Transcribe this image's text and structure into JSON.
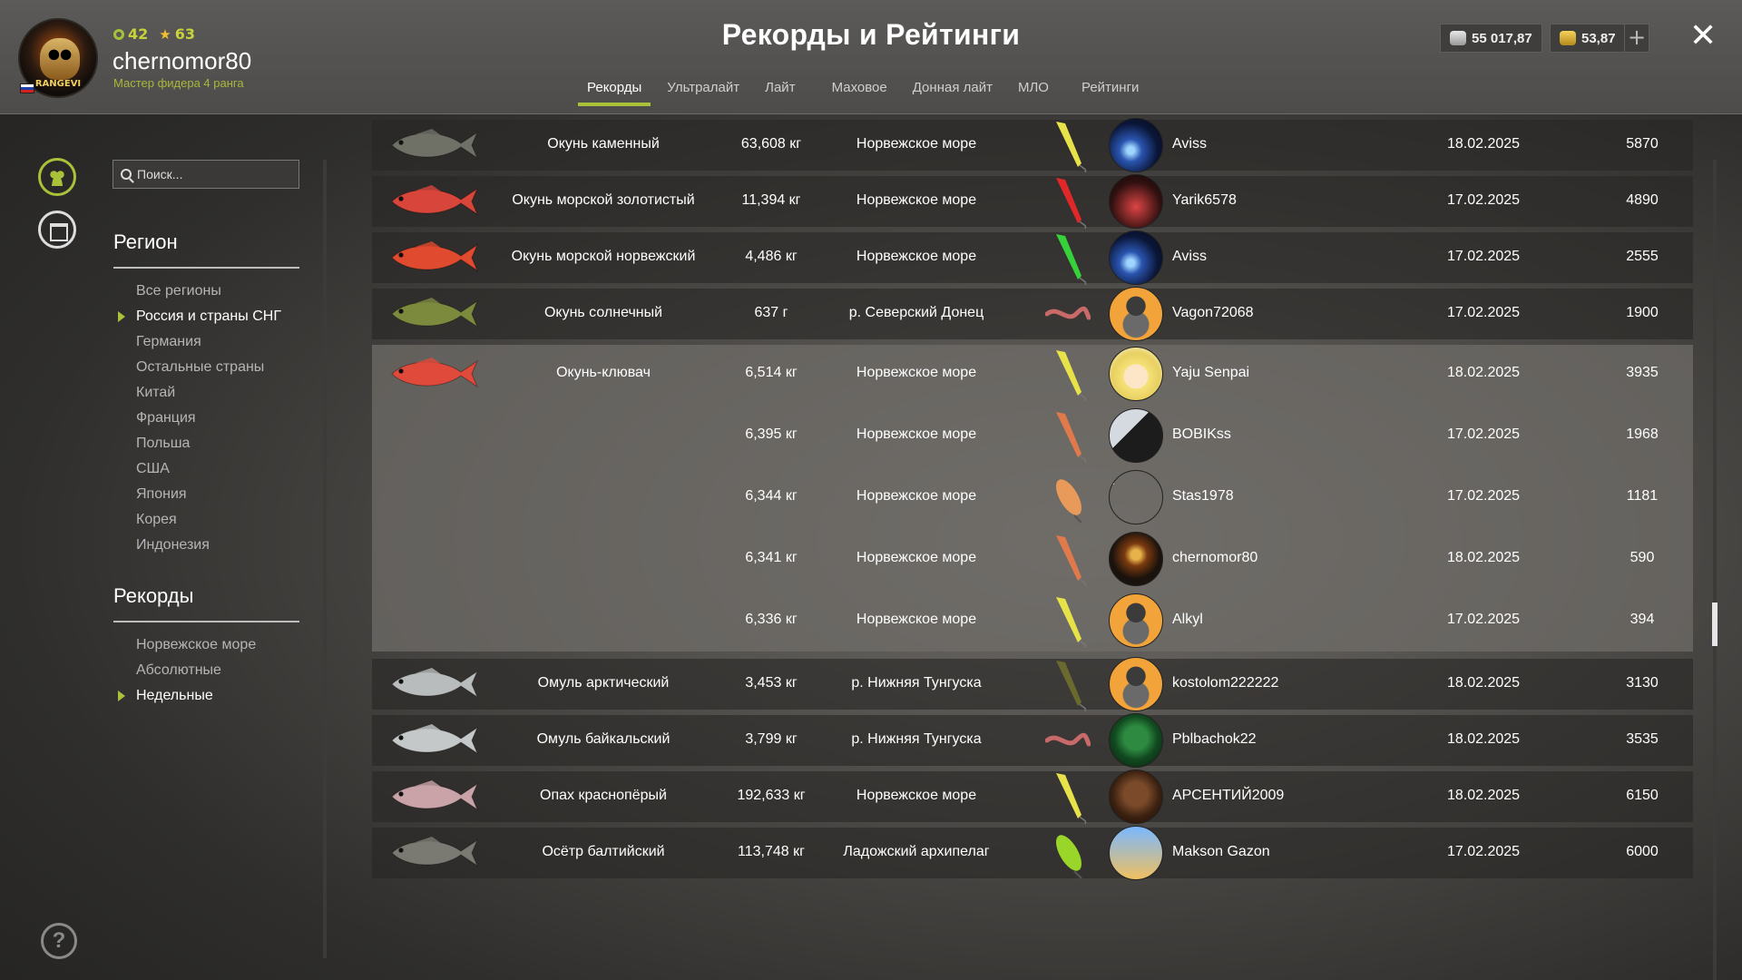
{
  "header": {
    "title": "Рекорды и Рейтинги",
    "user": {
      "name": "chernomor80",
      "rank": "Мастер фидера 4 ранга",
      "level": "42",
      "stars": "63",
      "avatar_tag": "RANGEVI"
    },
    "currency": {
      "silver": "55 017,87",
      "gold": "53,87"
    },
    "tabs": [
      "Рекорды",
      "Ультралайт",
      "Лайт",
      "Маховое",
      "Донная лайт",
      "МЛО",
      "Рейтинги"
    ],
    "active_tab": "Рекорды"
  },
  "search": {
    "placeholder": "Поиск..."
  },
  "regions": {
    "title": "Регион",
    "items": [
      "Все регионы",
      "Россия и страны СНГ",
      "Германия",
      "Остальные страны",
      "Китай",
      "Франция",
      "Польша",
      "США",
      "Япония",
      "Корея",
      "Индонезия"
    ],
    "selected": "Россия и страны СНГ"
  },
  "records_filter": {
    "title": "Рекорды",
    "items": [
      "Норвежское море",
      "Абсолютные",
      "Недельные"
    ],
    "selected": "Недельные"
  },
  "table": {
    "rows": [
      {
        "fish": "Окунь каменный",
        "weight": "63,608 кг",
        "location": "Норвежское море",
        "lure": "yellow-jig",
        "avatar": "space",
        "player": "Aviss",
        "date": "18.02.2025",
        "score": "5870",
        "fish_color": "#6f7066"
      },
      {
        "fish": "Окунь морской золотистый",
        "weight": "11,394 кг",
        "location": "Норвежское море",
        "lure": "red-jig",
        "avatar": "dark",
        "player": "Yarik6578",
        "date": "17.02.2025",
        "score": "4890",
        "fish_color": "#d8453a"
      },
      {
        "fish": "Окунь морской норвежский",
        "weight": "4,486 кг",
        "location": "Норвежское море",
        "lure": "green-jig",
        "avatar": "space",
        "player": "Aviss",
        "date": "17.02.2025",
        "score": "2555",
        "fish_color": "#e04a2e"
      },
      {
        "fish": "Окунь солнечный",
        "weight": "637 г",
        "location": "р. Северский Донец",
        "lure": "worm",
        "avatar": "fox",
        "player": "Vagon72068",
        "date": "17.02.2025",
        "score": "1900",
        "fish_color": "#7c8a3e"
      },
      {
        "fish": "Омуль арктический",
        "weight": "3,453 кг",
        "location": "р. Нижняя Тунгуска",
        "lure": "olive-jig",
        "avatar": "fox",
        "player": "kostolom222222",
        "date": "18.02.2025",
        "score": "3130",
        "fish_color": "#b8bcbc"
      },
      {
        "fish": "Омуль байкальский",
        "weight": "3,799 кг",
        "location": "р. Нижняя Тунгуска",
        "lure": "worm",
        "avatar": "green",
        "player": "Pblbachok22",
        "date": "18.02.2025",
        "score": "3535",
        "fish_color": "#c4c8c8"
      },
      {
        "fish": "Опах краснопёрый",
        "weight": "192,633 кг",
        "location": "Норвежское море",
        "lure": "yellow-jig",
        "avatar": "brown",
        "player": "АРСЕНТИЙ2009",
        "date": "18.02.2025",
        "score": "6150",
        "fish_color": "#c9a3a8"
      },
      {
        "fish": "Осётр балтийский",
        "weight": "113,748 кг",
        "location": "Ладожский архипелаг",
        "lure": "green-wobbler",
        "avatar": "sky",
        "player": "Makson Gazon",
        "date": "17.02.2025",
        "score": "6000",
        "fish_color": "#7a7a72"
      }
    ],
    "group": {
      "fish": "Окунь-клювач",
      "fish_color": "#e04a3a",
      "entries": [
        {
          "weight": "6,514 кг",
          "location": "Норвежское море",
          "lure": "yellow-jig",
          "avatar": "anime",
          "player": "Yaju Senpai",
          "date": "18.02.2025",
          "score": "3935"
        },
        {
          "weight": "6,395 кг",
          "location": "Норвежское море",
          "lure": "striped-jig",
          "avatar": "photo",
          "player": "BOBIKss",
          "date": "17.02.2025",
          "score": "1968"
        },
        {
          "weight": "6,344 кг",
          "location": "Норвежское море",
          "lure": "striped-wobbler",
          "avatar": "question",
          "player": "Stas1978",
          "date": "17.02.2025",
          "score": "1181"
        },
        {
          "weight": "6,341 кг",
          "location": "Норвежское море",
          "lure": "striped-jig",
          "avatar": "skull",
          "player": "chernomor80",
          "date": "18.02.2025",
          "score": "590"
        },
        {
          "weight": "6,336 кг",
          "location": "Норвежское море",
          "lure": "yellow-jig",
          "avatar": "fox",
          "player": "Alkyl",
          "date": "17.02.2025",
          "score": "394"
        }
      ]
    },
    "question_mark": "?"
  }
}
